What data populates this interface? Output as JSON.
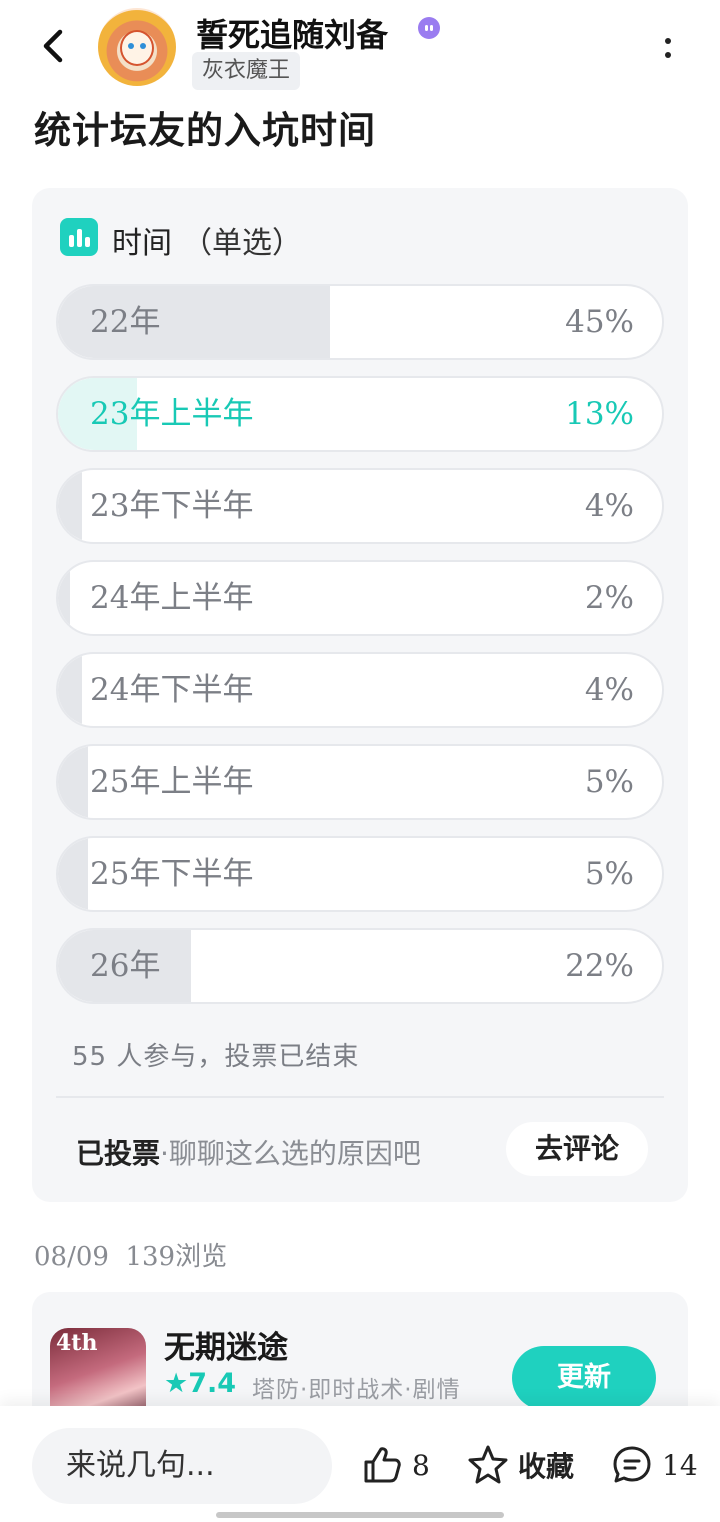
{
  "header": {
    "username": "誓死追随刘备",
    "user_tag": "灰衣魔王"
  },
  "post": {
    "title": "统计坛友的入坑时间"
  },
  "poll": {
    "label": "时间",
    "select_mode": "（单选）",
    "options": [
      {
        "label": "22年",
        "percent": "45%",
        "fraction": 0.45,
        "selected": false
      },
      {
        "label": "23年上半年",
        "percent": "13%",
        "fraction": 0.13,
        "selected": true
      },
      {
        "label": "23年下半年",
        "percent": "4%",
        "fraction": 0.04,
        "selected": false
      },
      {
        "label": "24年上半年",
        "percent": "2%",
        "fraction": 0.02,
        "selected": false
      },
      {
        "label": "24年下半年",
        "percent": "4%",
        "fraction": 0.04,
        "selected": false
      },
      {
        "label": "25年上半年",
        "percent": "5%",
        "fraction": 0.05,
        "selected": false
      },
      {
        "label": "25年下半年",
        "percent": "5%",
        "fraction": 0.05,
        "selected": false
      },
      {
        "label": "26年",
        "percent": "22%",
        "fraction": 0.22,
        "selected": false
      }
    ],
    "participation": "55 人参与，投票已结束",
    "voted_label": "已投票",
    "voted_hint": "·聊聊这么选的原因吧",
    "comment_button": "去评论"
  },
  "meta": {
    "date": "08/09",
    "views": "139浏览"
  },
  "app": {
    "icon_text": "4th",
    "name": "无期迷途",
    "rating": "★7.4",
    "tags": "塔防·即时战术·剧情",
    "update_button": "更新"
  },
  "bottom_bar": {
    "comment_placeholder": "来说几句...",
    "like_count": "8",
    "favorite_label": "收藏",
    "comment_count": "14"
  },
  "colors": {
    "accent": "#1fd1bf",
    "selected_text": "#18c9b5",
    "card_bg": "#f5f6f8"
  },
  "icons": [
    "back-arrow-icon",
    "verified-badge-icon",
    "more-vertical-icon",
    "poll-chart-icon",
    "thumbs-up-icon",
    "star-icon",
    "comment-bubble-icon"
  ]
}
